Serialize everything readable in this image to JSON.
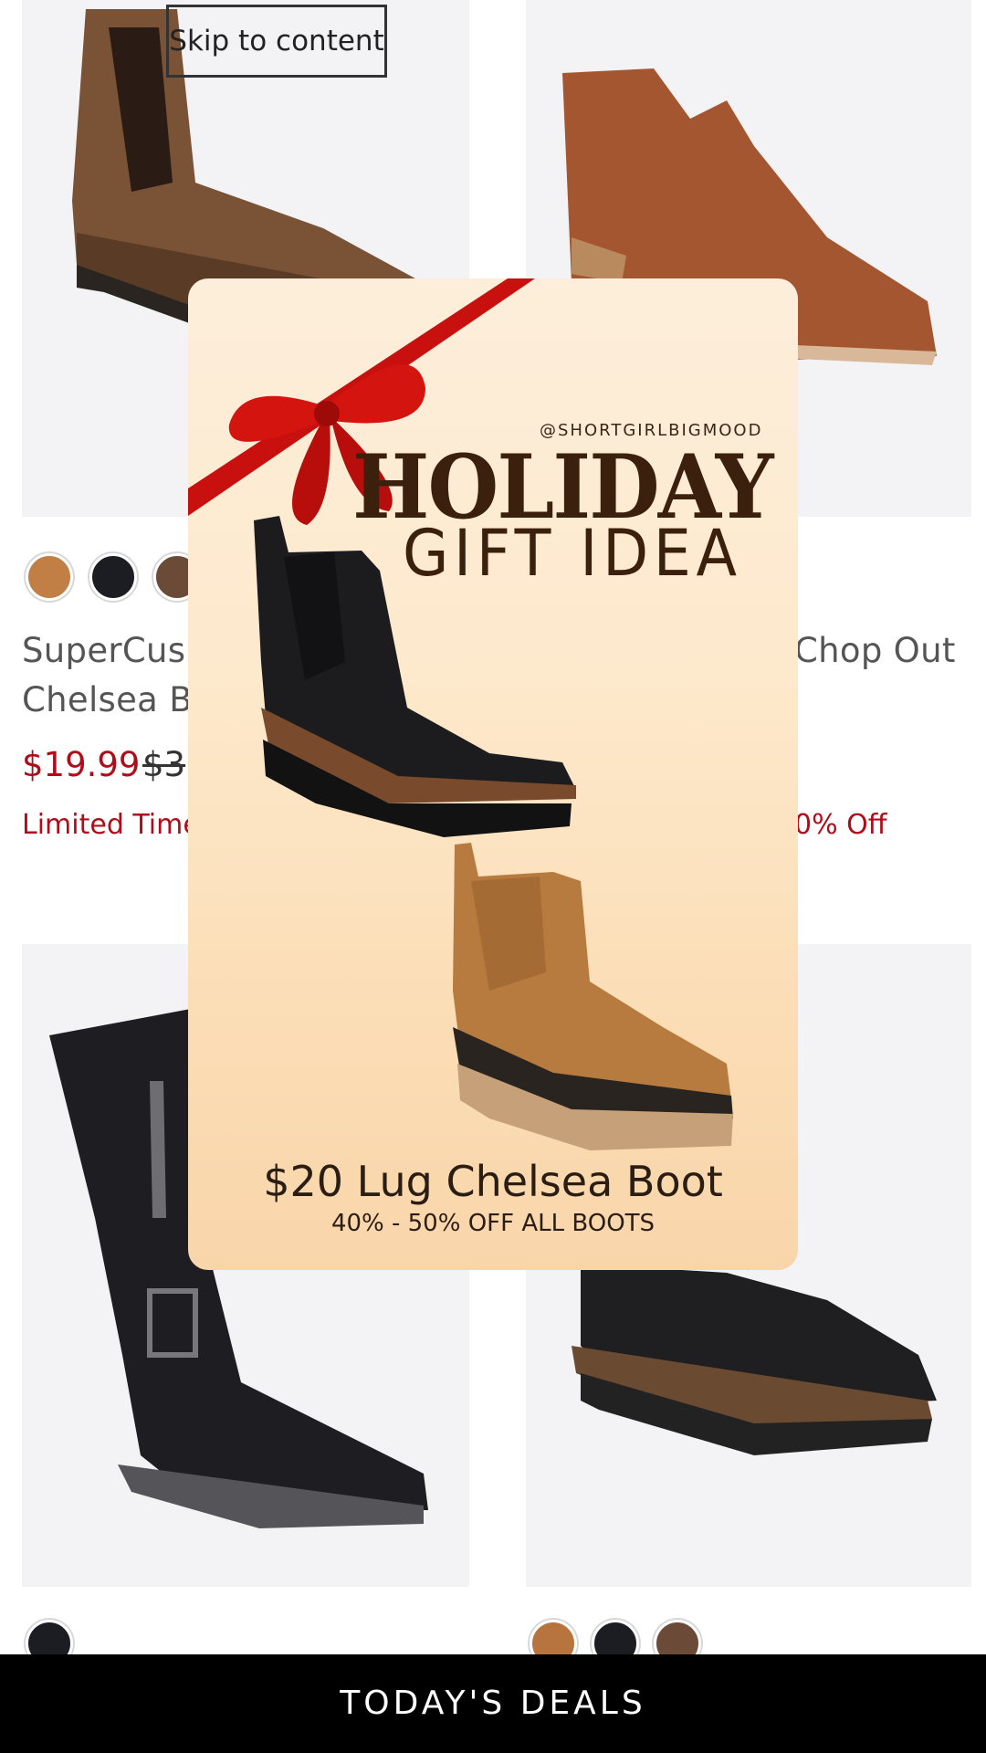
{
  "skip_link": "Skip to content",
  "products": [
    {
      "title_line1": "SuperCush",
      "title_line2": "Chelsea Bo",
      "price": "$19.99",
      "original_price": "$3",
      "promo": "Limited Time",
      "swatches": [
        "#c17f45",
        "#1c1d22",
        "#6b4a37"
      ]
    },
    {
      "title_line1": "Chop Out",
      "promo": "0% Off"
    },
    {
      "swatches": [
        "#1c1d22"
      ]
    },
    {
      "swatches": [
        "#b8743e",
        "#1c1d22",
        "#6b4a37"
      ]
    }
  ],
  "promo_card": {
    "handle": "@SHORTGIRLBIGMOOD",
    "headline": "HOLIDAY",
    "subheadline": "GIFT IDEA",
    "deal_title": "$20 Lug Chelsea Boot",
    "deal_subtitle": "40% - 50% OFF ALL BOOTS"
  },
  "bottom_bar": {
    "label": "TODAY'S DEALS"
  },
  "colors": {
    "sale_red": "#b00d1b",
    "card_bg": "#fde9cc",
    "headline_brown": "#3b200d",
    "bar_bg": "#000000"
  }
}
